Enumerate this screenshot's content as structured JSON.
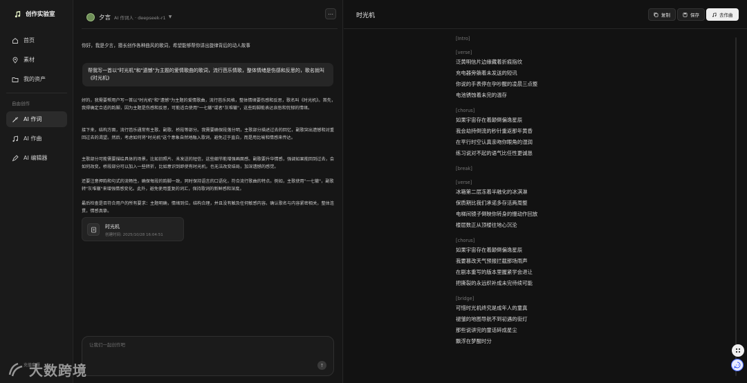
{
  "app": {
    "name": "创作实验室",
    "brand_color": "#e9f5c9"
  },
  "sidebar": {
    "items": [
      {
        "label": "首页",
        "icon": "home-icon"
      },
      {
        "label": "素材",
        "icon": "location-pin-icon"
      },
      {
        "label": "我的资产",
        "icon": "folder-icon"
      }
    ],
    "section_label": "自由创作",
    "tools": [
      {
        "label": "AI 作词",
        "icon": "pen-sparkle-icon",
        "active": true
      },
      {
        "label": "AI 作曲",
        "icon": "music-note-icon",
        "active": false
      },
      {
        "label": "AI 编辑器",
        "icon": "editor-icon",
        "active": false
      }
    ]
  },
  "chat": {
    "agent_name": "夕言",
    "agent_meta": "AI 作词人 · deepseek-r1",
    "greeting": "你好，我是夕言，擅长创作各种曲风的歌词，希望能够帮你讲出旋律背后的动人故事",
    "user_message": "帮我写一首以\"时光机\"和\"遗憾\"为主题的爱情歌曲的歌词，流行芭乐情歌，整体情绪是伤感和反思的，歌名就叫《时光机》",
    "reply_paragraphs": [
      "好的，我需要帮用户写一首以\"时光机\"和\"遗憾\"为主题的爱情歌曲，流行芭乐风格，整体情绪要伤感和反思，歌名叫《时光机》。首先，我得确定合适的韵脚，因为主题是伤感和反思，可能适合使用\"一七辙\"或者\"灰堆辙\"，这些韵脚能表达哀愁和忧郁的情绪。",
      "接下来，结构方面，流行芭乐通常有主歌、副歌、桥段等部分。我需要确保段落分明，主歌部分描述过去的回忆，副歌突出遗憾和对重回过去的渴望。然后，考虑如何将\"时光机\"这个意象自然地融入歌词，避免过于直白，而是用比喻和情感来传达。",
      "主歌部分可能需要描绘具体的场景，比如旧照片、未发送的短信，这些细节能增强画面感。副歌要升华情感，强调如果能回到过去，会如何改变。桥段部分可以加入一些转折，比如意识到即使有时光机，也无法改变结局，加深遗憾的感觉。",
      "还要注意押韵和句式的流畅性，确保每段的韵脚一致，同时保持语言的口语化，符合流行歌曲的特点。例如，主歌使用\"一七辙\"，副歌转\"灰堆辙\"来增强情感变化。此外，避免使用重复的词汇，保持歌词的新鲜感和深度。",
      "最后检查是否符合用户的所有要求：主题明确，情绪到位，结构合理，并且没有触及任何敏感内容。确认歌名与内容紧密相关，整体连贯，情感真挚。"
    ],
    "file_card": {
      "name": "时光机",
      "meta": "创建时间: 2025/10/28 16:04:51"
    },
    "composer_placeholder": "让我们一起创作吧",
    "watermark": {
      "text": "大数跨境",
      "sub": "充值套餐"
    }
  },
  "lyrics": {
    "title": "时光机",
    "toolbar": {
      "copy": "复制",
      "save": "保存",
      "compose": "去作曲"
    },
    "sections": [
      {
        "tag": "[Intro]",
        "lines": []
      },
      {
        "tag": "[verse]",
        "lines": [
          "泛黄明信片边缘藏着折痕指纹",
          "充电器旁躺着未发送的短讯",
          "你说的手表停在孕吵醒的凌晨三点整",
          "电池锈蚀着未完的温存"
        ]
      },
      {
        "tag": "[chorus]",
        "lines": [
          "如果宇宙存在着颠倒偏逸星辰",
          "我会劫持倒流的秒针重返那年黄昏",
          "在平行时空认真亲吻你眼角的湿润",
          "练习说对不起的语气比任性更诚恳"
        ]
      },
      {
        "tag": "[break]",
        "lines": []
      },
      {
        "tag": "[verse]",
        "lines": [
          "冰箱第二层冻着半融化的冰淇淋",
          "保质期比我们承诺多存活两周整",
          "电梯间镜子倒映你转身的慢动作回放",
          "楼层数正从顶楼往地心沉沦"
        ]
      },
      {
        "tag": "[chorus]",
        "lines": [
          "如果宇宙存在着颠倒偏逸星辰",
          "我要篡改天气预报拦截那场雨声",
          "在剧本重写的版本里握紧学会退让",
          "把撕裂的永远织补成未完待续可能"
        ]
      },
      {
        "tag": "[bridge]",
        "lines": [
          "可惜时光机终究是成年人的童真",
          "褪皱的地图导航不到初遇的街灯",
          "那些说讲完的童话碎成星尘",
          "飘浮在梦醒时分"
        ]
      }
    ]
  }
}
